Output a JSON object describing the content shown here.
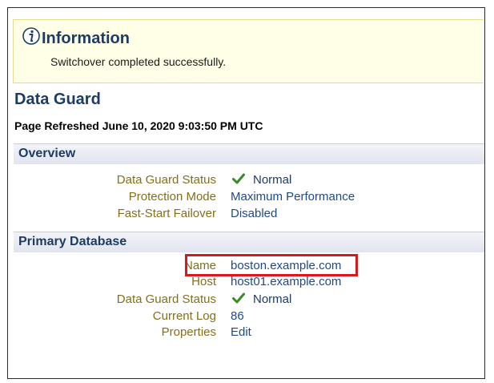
{
  "info": {
    "title": "Information",
    "message": "Switchover completed successfully.",
    "icon": "info-icon"
  },
  "page": {
    "title": "Data Guard",
    "refreshed": "Page Refreshed June 10, 2020 9:03:50 PM UTC"
  },
  "overview": {
    "heading": "Overview",
    "rows": [
      {
        "label": "Data Guard Status",
        "value": "Normal",
        "icon": "check-icon"
      },
      {
        "label": "Protection Mode",
        "value": "Maximum Performance"
      },
      {
        "label": "Fast-Start Failover",
        "value": "Disabled"
      }
    ]
  },
  "primary": {
    "heading": "Primary Database",
    "rows": [
      {
        "label": "Name",
        "value": "boston.example.com"
      },
      {
        "label": "Host",
        "value": "host01.example.com"
      },
      {
        "label": "Data Guard Status",
        "value": "Normal",
        "icon": "check-icon"
      },
      {
        "label": "Current Log",
        "value": "86"
      },
      {
        "label": "Properties",
        "value": "Edit"
      }
    ]
  },
  "colors": {
    "heading": "#1c3c63",
    "label": "#856e1a",
    "highlight": "#d61b1b",
    "check": "#3a8a2a"
  }
}
